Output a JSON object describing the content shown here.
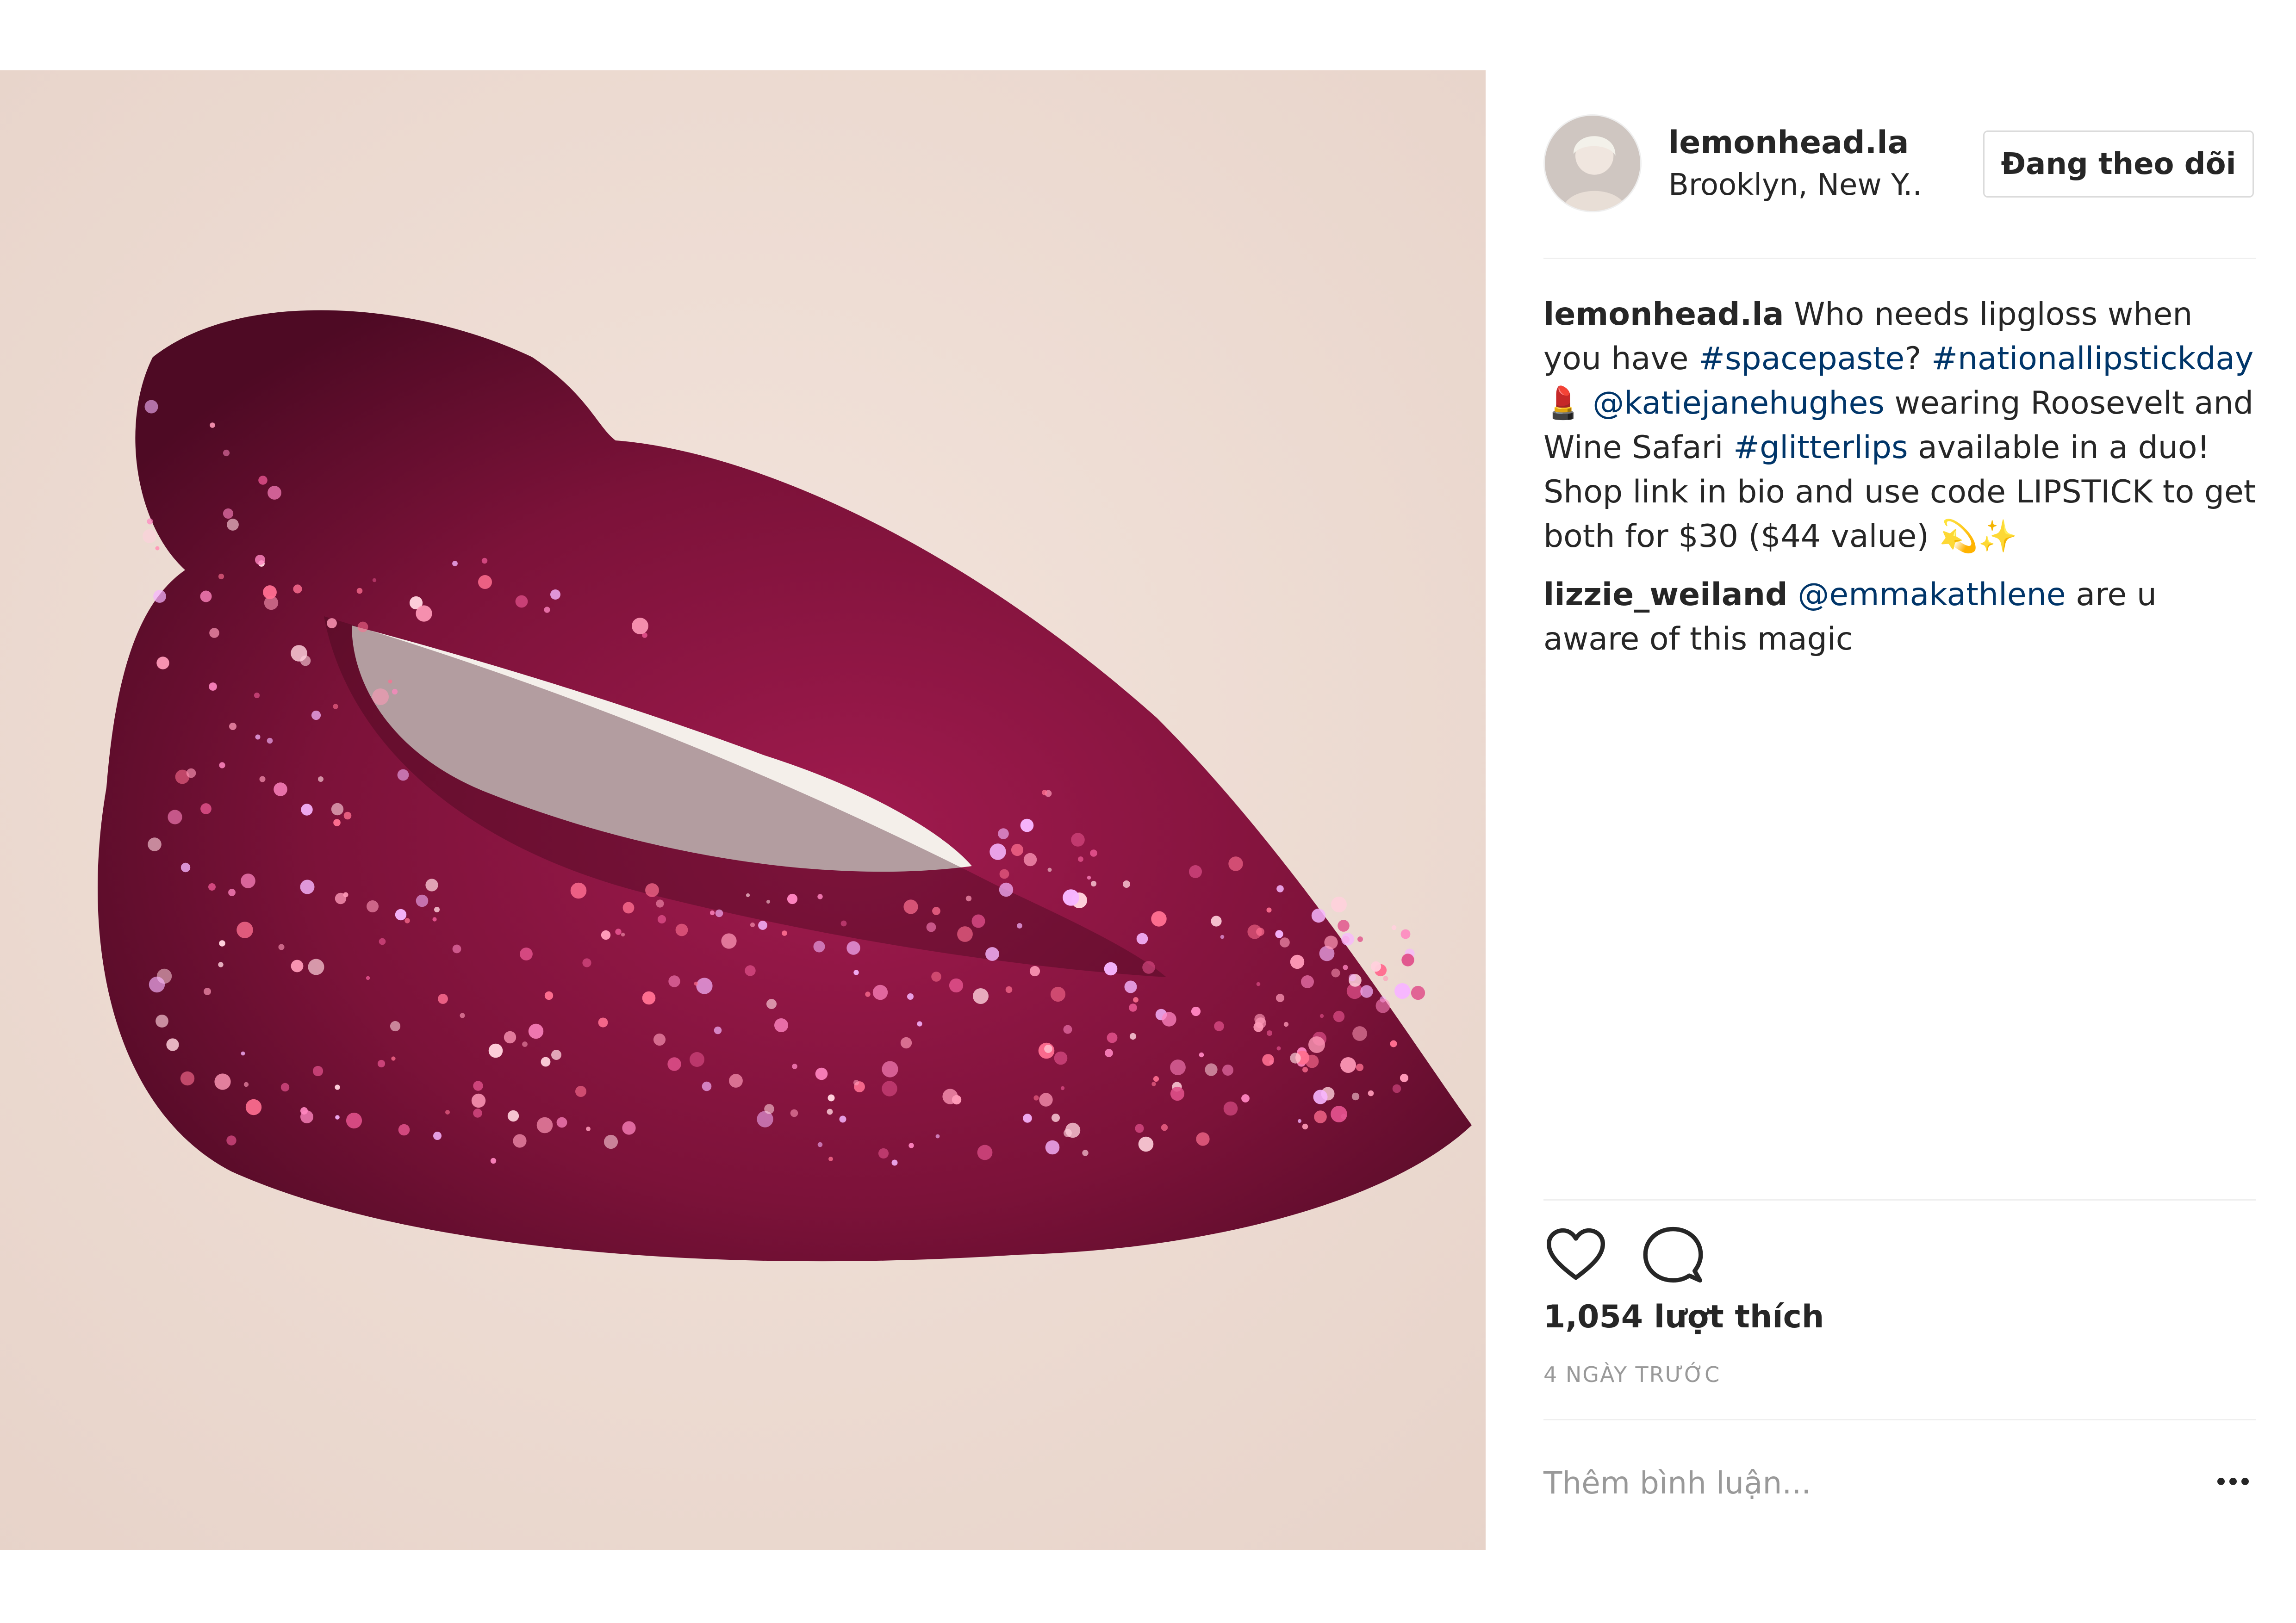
{
  "post": {
    "username": "lemonhead.la",
    "location": "Brooklyn, New Y..",
    "follow_label": "Đang theo dõi",
    "image_icon": "glitter-lips-photo",
    "avatar_icon": "profile-avatar"
  },
  "comments": [
    {
      "user": "lemonhead.la",
      "parts": [
        {
          "text": " Who needs lipgloss when you have ",
          "type": "text"
        },
        {
          "text": "#spacepaste",
          "type": "tag"
        },
        {
          "text": "? ",
          "type": "text"
        },
        {
          "text": "#nationallipstickday",
          "type": "tag"
        },
        {
          "text": " 💄 ",
          "type": "text"
        },
        {
          "text": "@katiejanehughes",
          "type": "tag"
        },
        {
          "text": " wearing Roosevelt and Wine Safari ",
          "type": "text"
        },
        {
          "text": "#glitterlips",
          "type": "tag"
        },
        {
          "text": " available in a duo! Shop link in bio and use code LIPSTICK to get both for $30 ($44 value) 💫✨",
          "type": "text"
        }
      ]
    },
    {
      "user": "lizzie_weiland",
      "parts": [
        {
          "text": " ",
          "type": "text"
        },
        {
          "text": "@emmakathlene",
          "type": "tag"
        },
        {
          "text": " are u aware of this magic",
          "type": "text"
        }
      ]
    }
  ],
  "actions": {
    "like_icon": "heart-icon",
    "comment_icon": "comment-bubble-icon",
    "more_icon": "more-dots-icon"
  },
  "likes_text": "1,054 lượt thích",
  "time_text": "4 NGÀY TRƯỚC",
  "comment_placeholder": "Thêm bình luận...",
  "colors": {
    "text": "#262626",
    "link": "#003569",
    "muted": "#999999",
    "border": "#efefef",
    "lip": "#7a1238"
  }
}
